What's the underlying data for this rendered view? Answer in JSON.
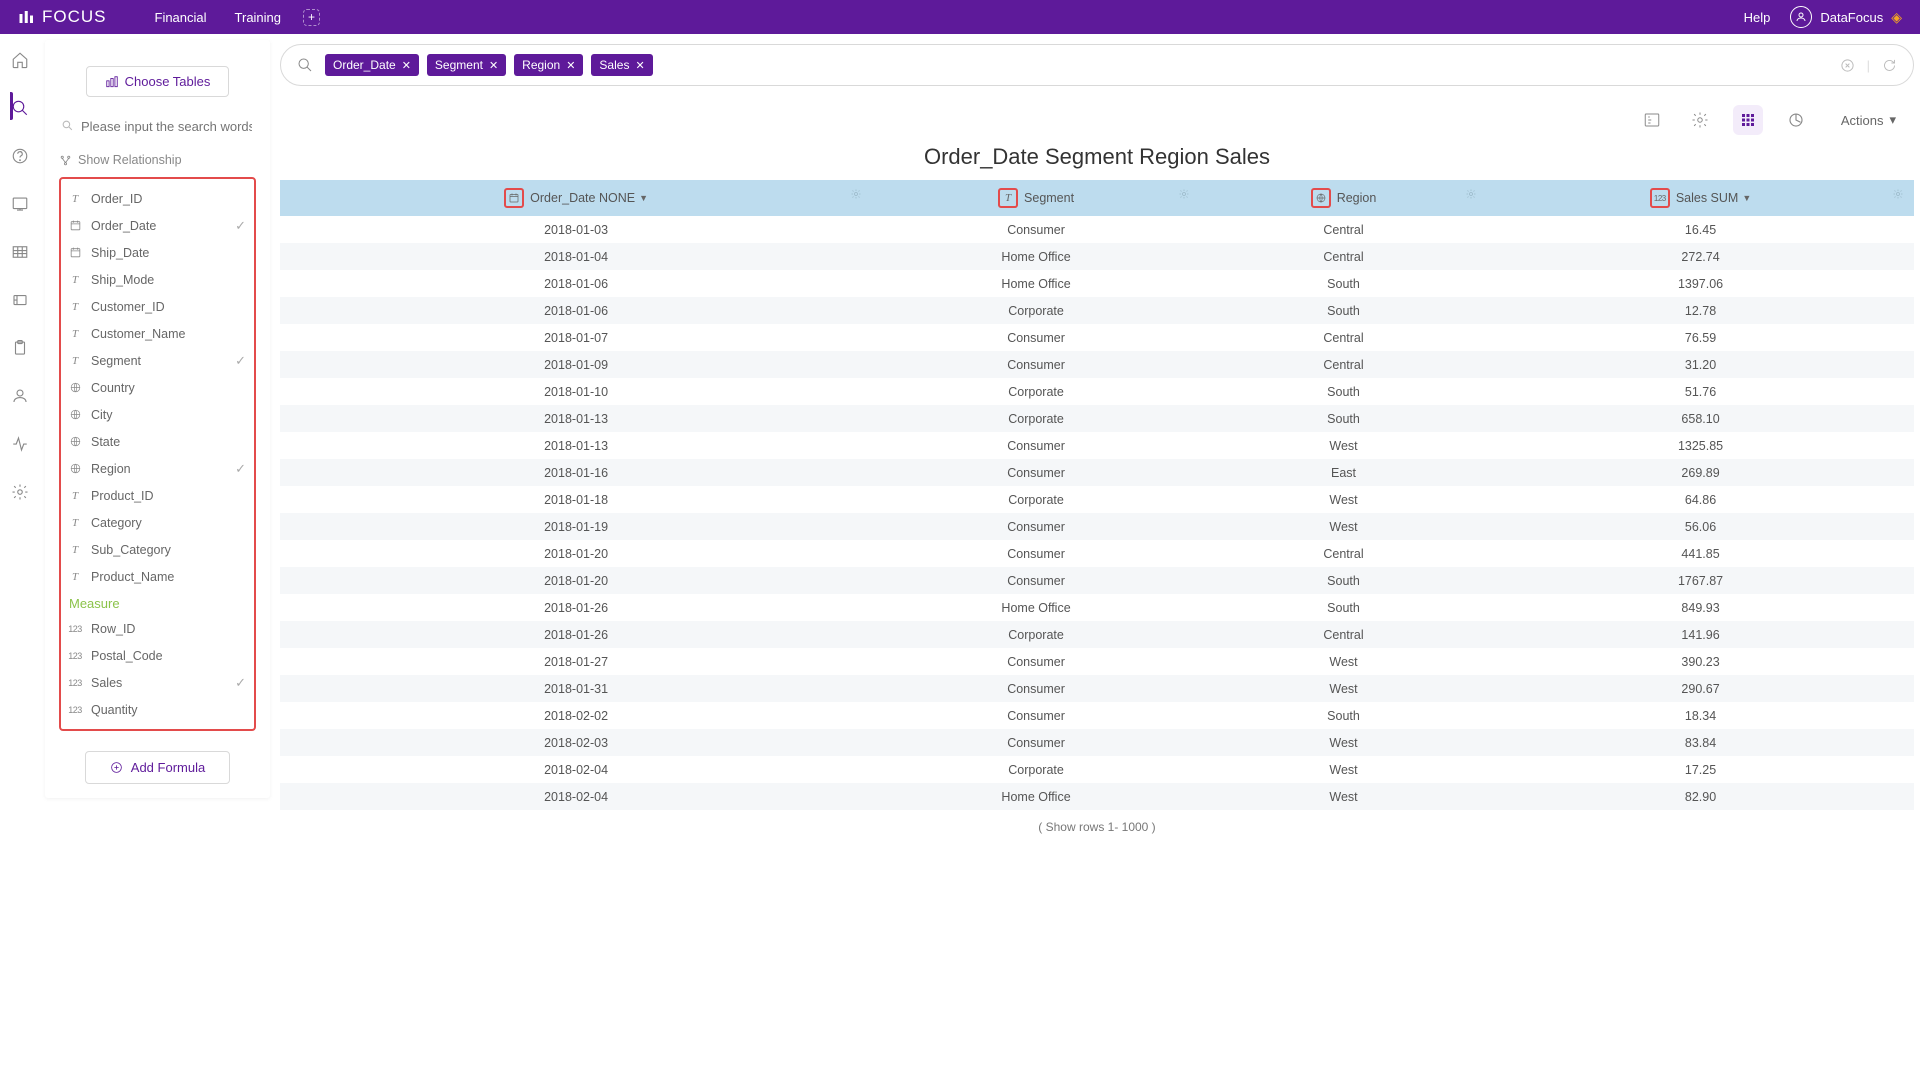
{
  "topbar": {
    "logo": "FOCUS",
    "tabs": [
      "Financial",
      "Training"
    ],
    "help": "Help",
    "user": "DataFocus"
  },
  "sidepanel": {
    "choose_tables": "Choose Tables",
    "search_placeholder": "Please input the search words",
    "show_relationship": "Show Relationship",
    "measure_label": "Measure",
    "add_formula": "Add Formula",
    "fields": [
      {
        "type": "txt",
        "name": "Order_ID"
      },
      {
        "type": "date",
        "name": "Order_Date",
        "checked": true
      },
      {
        "type": "date",
        "name": "Ship_Date"
      },
      {
        "type": "txt",
        "name": "Ship_Mode"
      },
      {
        "type": "txt",
        "name": "Customer_ID"
      },
      {
        "type": "txt",
        "name": "Customer_Name"
      },
      {
        "type": "txt",
        "name": "Segment",
        "checked": true
      },
      {
        "type": "geo",
        "name": "Country"
      },
      {
        "type": "geo",
        "name": "City"
      },
      {
        "type": "geo",
        "name": "State"
      },
      {
        "type": "geo",
        "name": "Region",
        "checked": true
      },
      {
        "type": "txt",
        "name": "Product_ID"
      },
      {
        "type": "txt",
        "name": "Category"
      },
      {
        "type": "txt",
        "name": "Sub_Category"
      },
      {
        "type": "txt",
        "name": "Product_Name"
      }
    ],
    "measures": [
      {
        "type": "num",
        "name": "Row_ID"
      },
      {
        "type": "num",
        "name": "Postal_Code"
      },
      {
        "type": "num",
        "name": "Sales",
        "checked": true
      },
      {
        "type": "num",
        "name": "Quantity"
      }
    ]
  },
  "query": {
    "pills": [
      "Order_Date",
      "Segment",
      "Region",
      "Sales"
    ]
  },
  "title": "Order_Date Segment Region Sales",
  "table": {
    "columns": [
      {
        "label": "Order_Date NONE",
        "icon": "date",
        "sort": true
      },
      {
        "label": "Segment",
        "icon": "txt"
      },
      {
        "label": "Region",
        "icon": "geo"
      },
      {
        "label": "Sales SUM",
        "icon": "num",
        "sort": true
      }
    ],
    "rows": [
      [
        "2018-01-03",
        "Consumer",
        "Central",
        "16.45"
      ],
      [
        "2018-01-04",
        "Home Office",
        "Central",
        "272.74"
      ],
      [
        "2018-01-06",
        "Home Office",
        "South",
        "1397.06"
      ],
      [
        "2018-01-06",
        "Corporate",
        "South",
        "12.78"
      ],
      [
        "2018-01-07",
        "Consumer",
        "Central",
        "76.59"
      ],
      [
        "2018-01-09",
        "Consumer",
        "Central",
        "31.20"
      ],
      [
        "2018-01-10",
        "Corporate",
        "South",
        "51.76"
      ],
      [
        "2018-01-13",
        "Corporate",
        "South",
        "658.10"
      ],
      [
        "2018-01-13",
        "Consumer",
        "West",
        "1325.85"
      ],
      [
        "2018-01-16",
        "Consumer",
        "East",
        "269.89"
      ],
      [
        "2018-01-18",
        "Corporate",
        "West",
        "64.86"
      ],
      [
        "2018-01-19",
        "Consumer",
        "West",
        "56.06"
      ],
      [
        "2018-01-20",
        "Consumer",
        "Central",
        "441.85"
      ],
      [
        "2018-01-20",
        "Consumer",
        "South",
        "1767.87"
      ],
      [
        "2018-01-26",
        "Home Office",
        "South",
        "849.93"
      ],
      [
        "2018-01-26",
        "Corporate",
        "Central",
        "141.96"
      ],
      [
        "2018-01-27",
        "Consumer",
        "West",
        "390.23"
      ],
      [
        "2018-01-31",
        "Consumer",
        "West",
        "290.67"
      ],
      [
        "2018-02-02",
        "Consumer",
        "South",
        "18.34"
      ],
      [
        "2018-02-03",
        "Consumer",
        "West",
        "83.84"
      ],
      [
        "2018-02-04",
        "Corporate",
        "West",
        "17.25"
      ],
      [
        "2018-02-04",
        "Home Office",
        "West",
        "82.90"
      ]
    ],
    "footer": "( Show rows 1- 1000 )"
  },
  "actions_label": "Actions"
}
